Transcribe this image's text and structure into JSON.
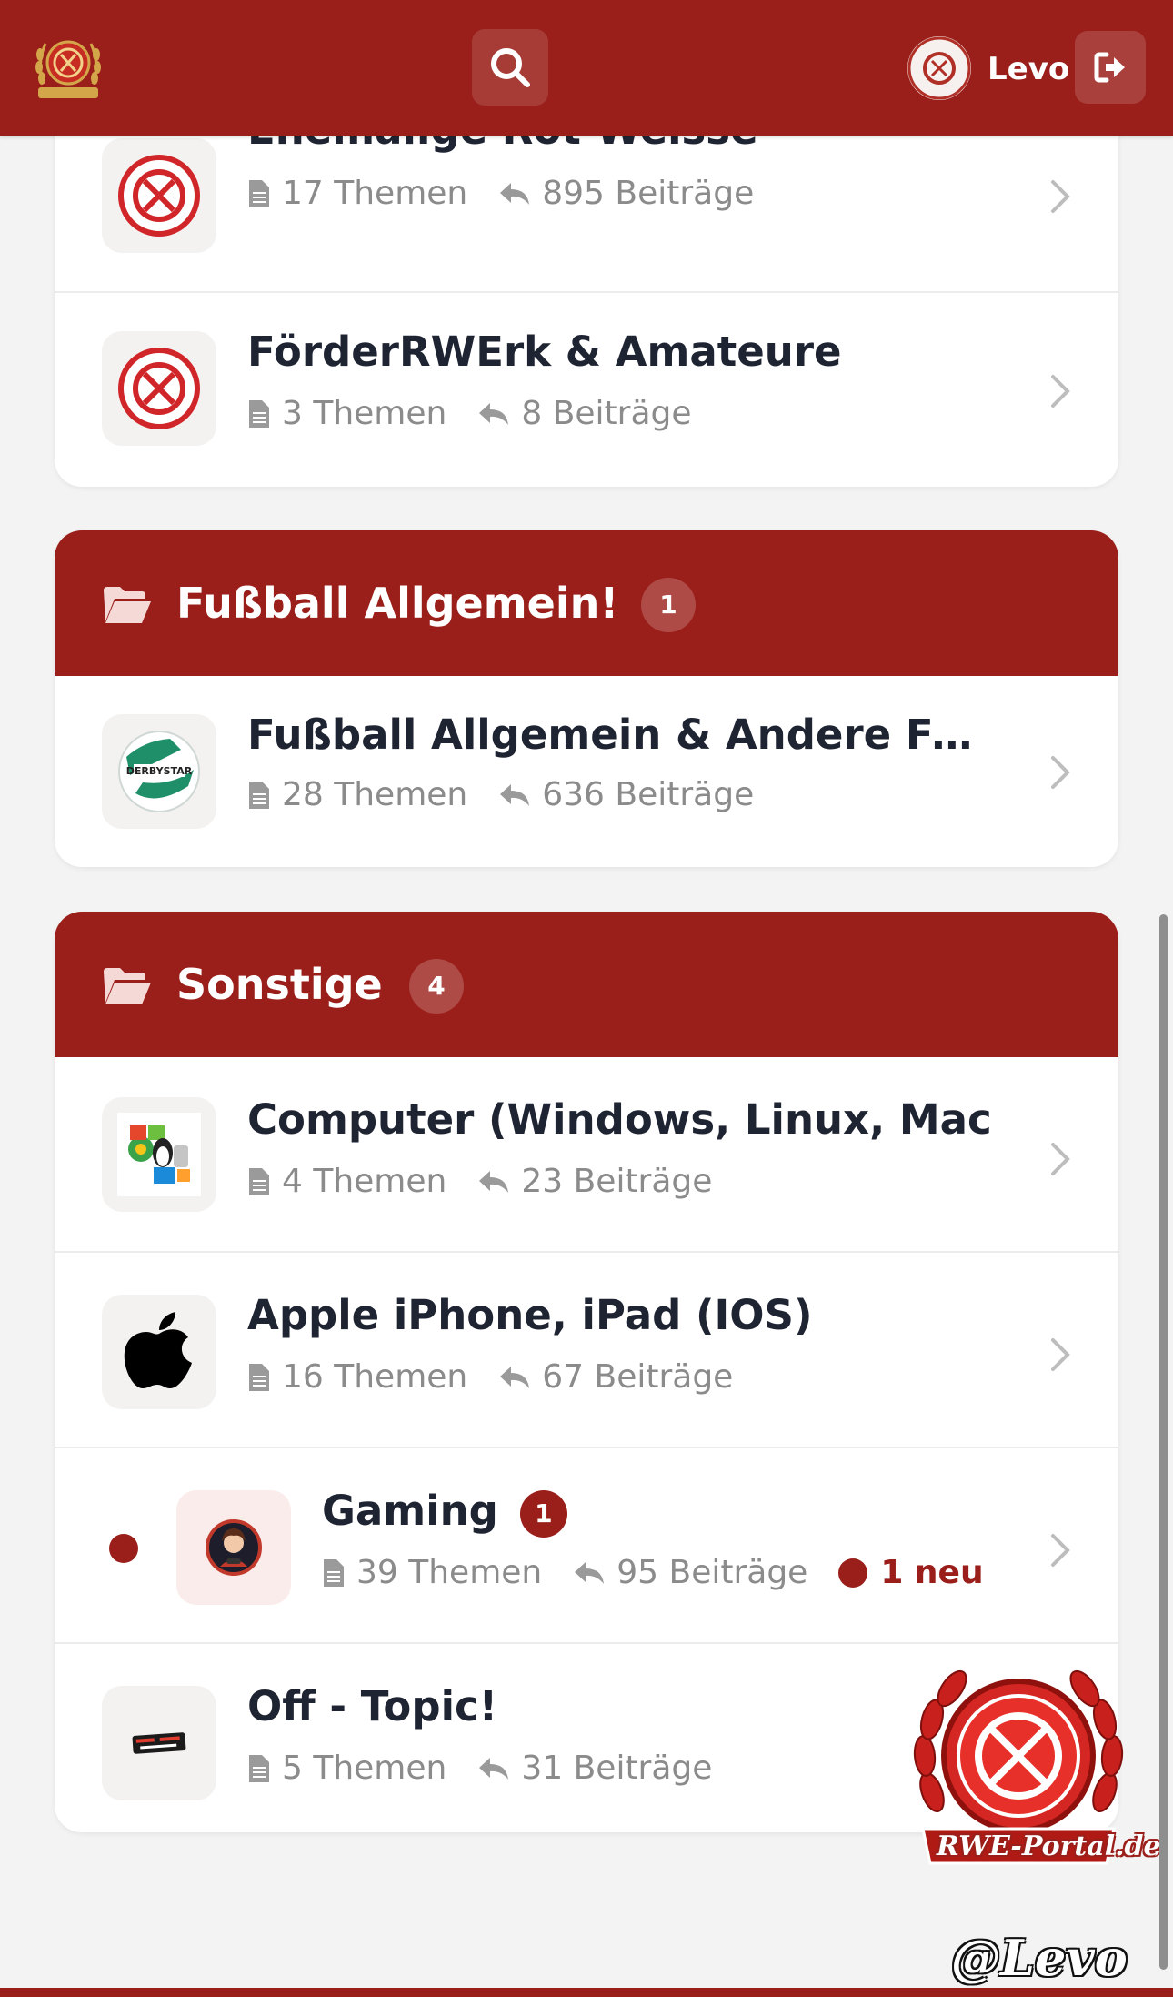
{
  "header": {
    "user_name": "Levo",
    "logo_icon": "rwe-portal-crest-icon",
    "search_icon": "search-icon",
    "logout_icon": "logout-icon"
  },
  "sections": [
    {
      "forums": [
        {
          "title": "Ehemalige Rot-Weisse",
          "topics": "17 Themen",
          "posts": "895 Beiträge",
          "icon": "rwe-crest-icon"
        },
        {
          "title": "FörderRWErk & Amateure",
          "topics": "3 Themen",
          "posts": "8 Beiträge",
          "icon": "rwe-crest-icon"
        }
      ]
    },
    {
      "title": "Fußball Allgemein!",
      "count": "1",
      "forums": [
        {
          "title": "Fußball Allgemein & Andere Fußball",
          "topics": "28 Themen",
          "posts": "636 Beiträge",
          "icon": "derbystar-ball-icon"
        }
      ]
    },
    {
      "title": "Sonstige",
      "count": "4",
      "forums": [
        {
          "title": "Computer (Windows, Linux, Mac",
          "topics": "4 Themen",
          "posts": "23 Beiträge",
          "icon": "computer-os-icon"
        },
        {
          "title": "Apple iPhone, iPad (IOS)",
          "topics": "16 Themen",
          "posts": "67 Beiträge",
          "icon": "apple-icon"
        },
        {
          "title": "Gaming",
          "badge": "1",
          "topics": "39 Themen",
          "posts": "95 Beiträge",
          "new_label": "1 neu",
          "icon": "gamer-avatar-icon"
        },
        {
          "title": "Off - Topic!",
          "topics": "5 Themen",
          "posts": "31 Beiträge",
          "icon": "off-topic-icon"
        }
      ]
    }
  ],
  "watermark": {
    "portal_text": "RWE-Portal.de",
    "credit": "@Levo"
  },
  "colors": {
    "brand": "#9a1f1a",
    "background": "#f3f3f3",
    "text": "#1f2433",
    "muted": "#8b8b8b"
  }
}
